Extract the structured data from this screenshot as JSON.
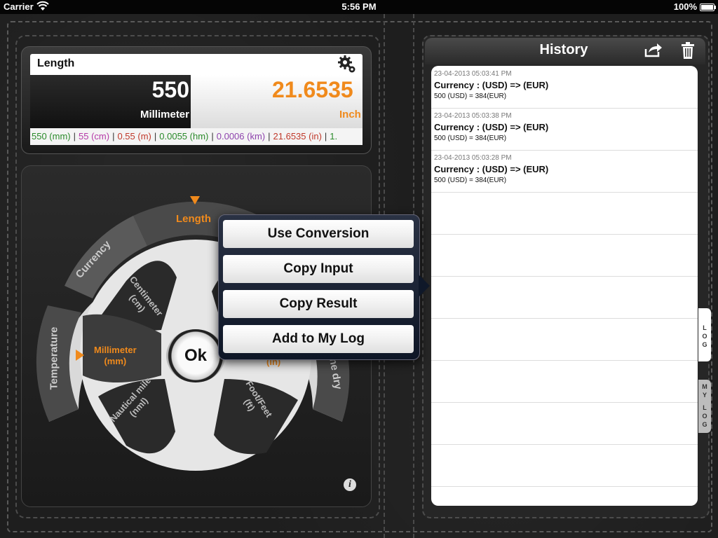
{
  "status_bar": {
    "carrier": "Carrier",
    "time": "5:56 PM",
    "battery": "100%"
  },
  "converter": {
    "category_title": "Length",
    "input_value": "550",
    "input_unit": "Millimeter",
    "output_value": "21.6535",
    "output_unit": "Inch",
    "strip_values": [
      {
        "text": "550 (mm)",
        "color": "#2a8a2a"
      },
      {
        "text": "55 (cm)",
        "color": "#b53aa8"
      },
      {
        "text": "0.55 (m)",
        "color": "#c0392b"
      },
      {
        "text": "0.0055 (hm)",
        "color": "#2a8a2a"
      },
      {
        "text": "0.0006 (km)",
        "color": "#8e44ad"
      },
      {
        "text": "21.6535 (in)",
        "color": "#c0392b"
      },
      {
        "text": "1.",
        "color": "#2a8a2a"
      }
    ],
    "separator": "|",
    "wheel": {
      "outer_categories": [
        "Length",
        "Currency",
        "Temperature",
        "ne dry"
      ],
      "inner_units": [
        "Centimeter\n(cm)",
        "Millimeter\n(mm)",
        "Nautical mile\n(nml)",
        "Foot/Feet\n(ft)",
        "(in)"
      ],
      "ok_label": "Ok"
    },
    "info_label": "i"
  },
  "history": {
    "title": "History",
    "entries": [
      {
        "date": "23-04-2013 05:03:41 PM",
        "title": "Currency : (USD) => (EUR)",
        "detail": "500 (USD) = 384(EUR)"
      },
      {
        "date": "23-04-2013 05:03:38 PM",
        "title": "Currency : (USD) => (EUR)",
        "detail": "500 (USD) = 384(EUR)"
      },
      {
        "date": "23-04-2013 05:03:28 PM",
        "title": "Currency : (USD) => (EUR)",
        "detail": "500 (USD) = 384(EUR)"
      }
    ],
    "tabs": {
      "log": [
        "L",
        "O",
        "G"
      ],
      "my_log": [
        "M",
        "Y",
        "L",
        "O",
        "G"
      ]
    }
  },
  "popover": {
    "items": [
      "Use Conversion",
      "Copy Input",
      "Copy Result",
      "Add to My Log"
    ]
  },
  "colors": {
    "accent_orange": "#f08a1c",
    "popover_bg": "#0e1626"
  }
}
